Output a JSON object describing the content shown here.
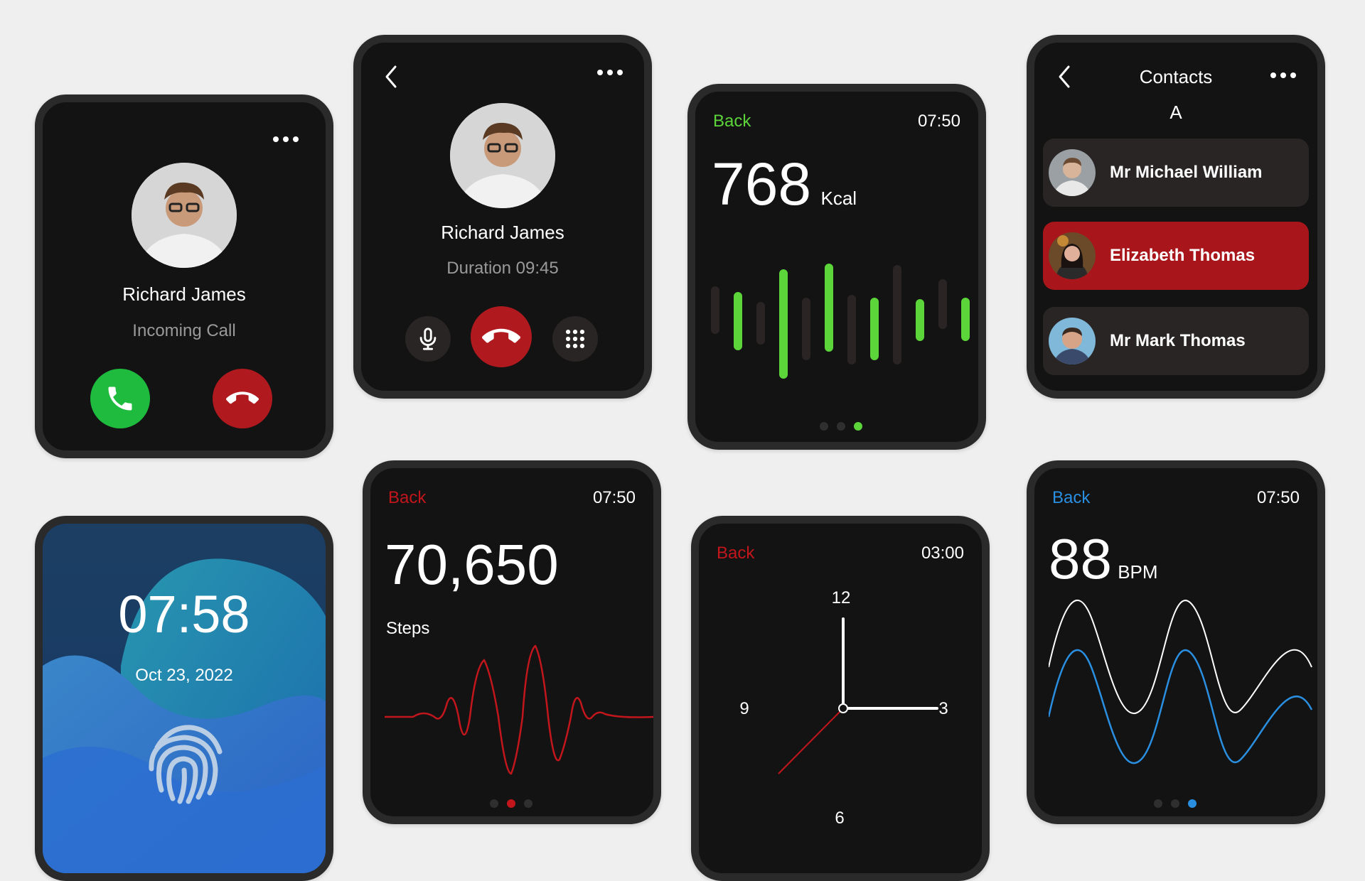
{
  "incoming_call": {
    "caller_name": "Richard James",
    "status": "Incoming Call",
    "accept_icon": "phone-accept-icon",
    "decline_icon": "phone-decline-icon",
    "accept_color": "#1fbb3f",
    "decline_color": "#b01a1f"
  },
  "active_call": {
    "caller_name": "Richard James",
    "duration": "Duration 09:45"
  },
  "calories": {
    "back_label": "Back",
    "time": "07:50",
    "value": "768",
    "unit": "Kcal",
    "accent": "#5bd53a",
    "bars_green": [
      0.65,
      1.0,
      0.75,
      0.55,
      0.45,
      0.3
    ],
    "page": 3
  },
  "contacts": {
    "title": "Contacts",
    "section": "A",
    "items": [
      {
        "name": "Mr Michael William",
        "active": false
      },
      {
        "name": "Elizabeth Thomas",
        "active": true
      },
      {
        "name": "Mr Mark Thomas",
        "active": false
      }
    ],
    "active_color": "#a8161c"
  },
  "lock": {
    "time": "07:58",
    "date": "Oct 23, 2022",
    "icon": "fingerprint-icon"
  },
  "steps": {
    "back_label": "Back",
    "time": "07:50",
    "value": "70,650",
    "label": "Steps",
    "accent": "#c2161c",
    "page": 2
  },
  "analog": {
    "back_label": "Back",
    "time": "03:00",
    "n12": "12",
    "n3": "3",
    "n6": "6",
    "n9": "9",
    "accent": "#c2161c"
  },
  "heart": {
    "back_label": "Back",
    "time": "07:50",
    "value": "88",
    "unit": "BPM",
    "accent": "#2a8fe0",
    "page": 3
  }
}
